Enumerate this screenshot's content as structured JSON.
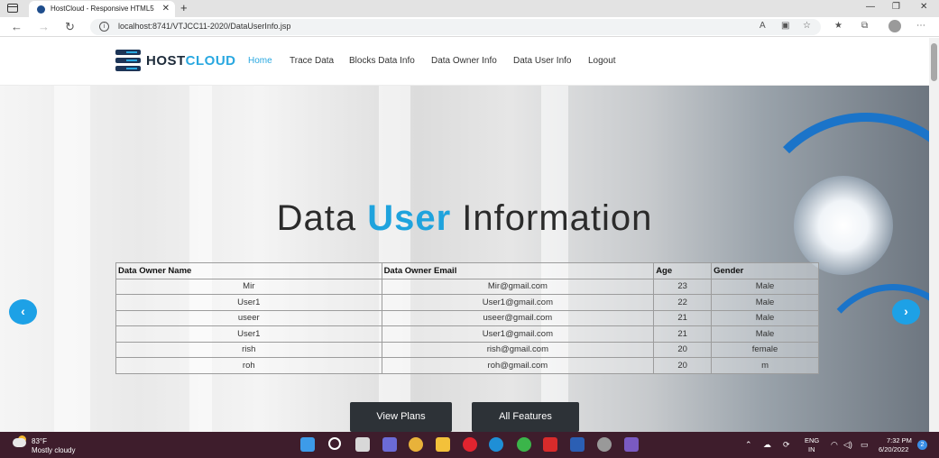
{
  "browser": {
    "tab_title": "HostCloud - Responsive HTML5",
    "url": "localhost:8741/VTJCC11-2020/DataUserInfo.jsp"
  },
  "site": {
    "logo_main": "HOST",
    "logo_accent": "CLOUD",
    "nav": [
      {
        "label": "Home",
        "active": true
      },
      {
        "label": "Trace Data"
      },
      {
        "label": "Blocks Data Info"
      },
      {
        "label": "Data Owner Info"
      },
      {
        "label": "Data User Info"
      },
      {
        "label": "Logout"
      }
    ]
  },
  "hero": {
    "title_part1": "Data ",
    "title_accent": "User",
    "title_part2": " Information",
    "prev_arrow": "‹",
    "next_arrow": "›",
    "buttons": [
      "View Plans",
      "All Features"
    ]
  },
  "table": {
    "headers": [
      "Data Owner Name",
      "Data Owner Email",
      "Age",
      "Gender"
    ],
    "rows": [
      [
        "Mir",
        "Mir@gmail.com",
        "23",
        "Male"
      ],
      [
        "User1",
        "User1@gmail.com",
        "22",
        "Male"
      ],
      [
        "useer",
        "useer@gmail.com",
        "21",
        "Male"
      ],
      [
        "User1",
        "User1@gmail.com",
        "21",
        "Male"
      ],
      [
        "rish",
        "rish@gmail.com",
        "20",
        "female"
      ],
      [
        "roh",
        "roh@gmail.com",
        "20",
        "m"
      ]
    ]
  },
  "taskbar": {
    "temperature": "83°F",
    "weather": "Mostly cloudy",
    "lang_top": "ENG",
    "lang_bottom": "IN",
    "time": "7:32 PM",
    "date": "6/20/2022",
    "notifications": "2"
  },
  "colors": {
    "accent": "#1fa3dd",
    "button_dark": "#2d3237",
    "taskbar": "#3e1d2c"
  }
}
